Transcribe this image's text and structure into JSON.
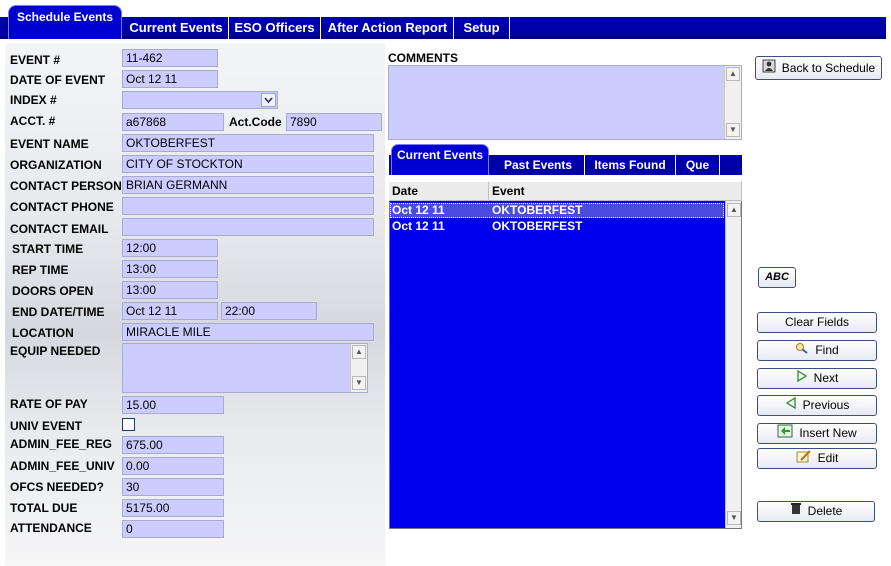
{
  "top_tabs": {
    "active": "Schedule Events",
    "items": [
      "Current Events",
      "ESO Officers",
      "After Action Report",
      "Setup"
    ]
  },
  "form": {
    "event_no": {
      "label": "EVENT #",
      "value": "11-462"
    },
    "date_of_event": {
      "label": "DATE OF EVENT",
      "value": "Oct 12 11"
    },
    "index": {
      "label": "INDEX #",
      "value": ""
    },
    "acct": {
      "label": "ACCT. #",
      "value": "a67868"
    },
    "act_code": {
      "label": "Act.Code",
      "value": "7890"
    },
    "event_name": {
      "label": "EVENT NAME",
      "value": "OKTOBERFEST"
    },
    "organization": {
      "label": "ORGANIZATION",
      "value": "CITY OF STOCKTON"
    },
    "contact_person": {
      "label": "CONTACT PERSON",
      "value": "BRIAN GERMANN"
    },
    "contact_phone": {
      "label": "CONTACT PHONE",
      "value": ""
    },
    "contact_email": {
      "label": "CONTACT EMAIL",
      "value": ""
    },
    "start_time": {
      "label": "START TIME",
      "value": "12:00"
    },
    "rep_time": {
      "label": "REP TIME",
      "value": "13:00"
    },
    "doors_open": {
      "label": "DOORS OPEN",
      "value": "13:00"
    },
    "end_datetime": {
      "label": "END DATE/TIME",
      "date": "Oct 12 11",
      "time": "22:00"
    },
    "location": {
      "label": "LOCATION",
      "value": "MIRACLE MILE"
    },
    "equip_needed": {
      "label": "EQUIP NEEDED",
      "value": ""
    },
    "rate_of_pay": {
      "label": "RATE OF PAY",
      "value": "15.00"
    },
    "univ_event": {
      "label": "UNIV EVENT",
      "checked": false
    },
    "admin_fee_reg": {
      "label": "ADMIN_FEE_REG",
      "value": "675.00"
    },
    "admin_fee_univ": {
      "label": "ADMIN_FEE_UNIV",
      "value": "0.00"
    },
    "ofcs_needed": {
      "label": "OFCS NEEDED?",
      "value": "30"
    },
    "total_due": {
      "label": "TOTAL DUE",
      "value": "5175.00"
    },
    "attendance": {
      "label": "ATTENDANCE",
      "value": "0"
    }
  },
  "comments": {
    "label": "COMMENTS",
    "value": ""
  },
  "sub_tabs": {
    "active": "Current Events",
    "items": [
      "Past Events",
      "Items Found",
      "Que"
    ]
  },
  "events_table": {
    "columns": [
      "Date",
      "Event"
    ],
    "rows": [
      {
        "date": "Oct 12 11",
        "event": "OKTOBERFEST"
      },
      {
        "date": "Oct 12 11",
        "event": "OKTOBERFEST"
      }
    ]
  },
  "buttons": {
    "back": "Back to Schedule",
    "abc": "ABC",
    "clear": "Clear Fields",
    "find": "Find",
    "next": "Next",
    "previous": "Previous",
    "insert": "Insert New",
    "edit": "Edit",
    "delete": "Delete"
  },
  "colors": {
    "tab_bar": "#0000aa",
    "field_bg": "#ccccff",
    "grid_bg": "#0000ee"
  }
}
